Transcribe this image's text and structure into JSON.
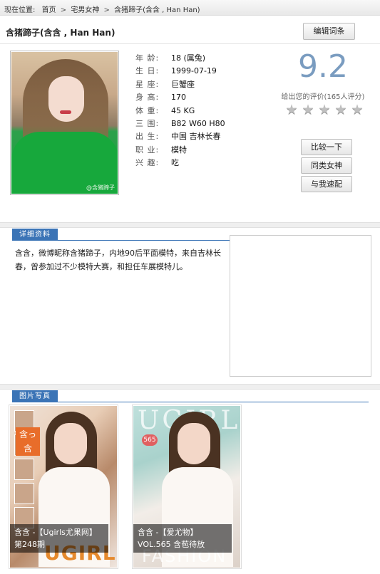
{
  "breadcrumb": {
    "prefix": "现在位置:",
    "items": [
      "首页",
      "宅男女神",
      "含猪蹄子(含含 , Han Han)"
    ],
    "sep": ">"
  },
  "header": {
    "title": "含猪蹄子(含含 , Han Han)",
    "edit_label": "编辑词条"
  },
  "profile": {
    "photo_watermark": "@含猪蹄子",
    "fields": [
      {
        "label": "年 龄:",
        "value": "18 (属兔)"
      },
      {
        "label": "生 日:",
        "value": "1999-07-19"
      },
      {
        "label": "星 座:",
        "value": "巨蟹座"
      },
      {
        "label": "身 高:",
        "value": "170"
      },
      {
        "label": "体 重:",
        "value": "45 KG"
      },
      {
        "label": "三 围:",
        "value": "B82 W60 H80"
      },
      {
        "label": "出 生:",
        "value": "中国 吉林长春"
      },
      {
        "label": "职 业:",
        "value": "模特"
      },
      {
        "label": "兴 趣:",
        "value": "吃"
      }
    ]
  },
  "rating": {
    "score": "9.2",
    "prompt": "给出您的评价(165人评分)",
    "stars": 5,
    "star_glyph": "★"
  },
  "actions": {
    "compare": "比较一下",
    "similar": "同类女神",
    "match": "与我速配"
  },
  "details": {
    "tab_label": "详细资料",
    "text": "含含，微博昵称含猪蹄子，内地90后平面模特，来自吉林长春，曾参加过不少模特大赛，和担任车展模特儿。"
  },
  "gallery": {
    "tab_label": "图片写真",
    "items": [
      {
        "caption": "含含 -【Ugirls尤果网】第248期",
        "brand": "UGIRLS",
        "badge": "含っ含"
      },
      {
        "caption": "含含 -【爱尤物】VOL.565 含苞待放",
        "brand": "UGIRLS",
        "brand_bottom": "FASHION",
        "badge": "565"
      }
    ]
  },
  "colors": {
    "accent_blue": "#3b74b6",
    "score_blue": "#7a9cc0"
  }
}
